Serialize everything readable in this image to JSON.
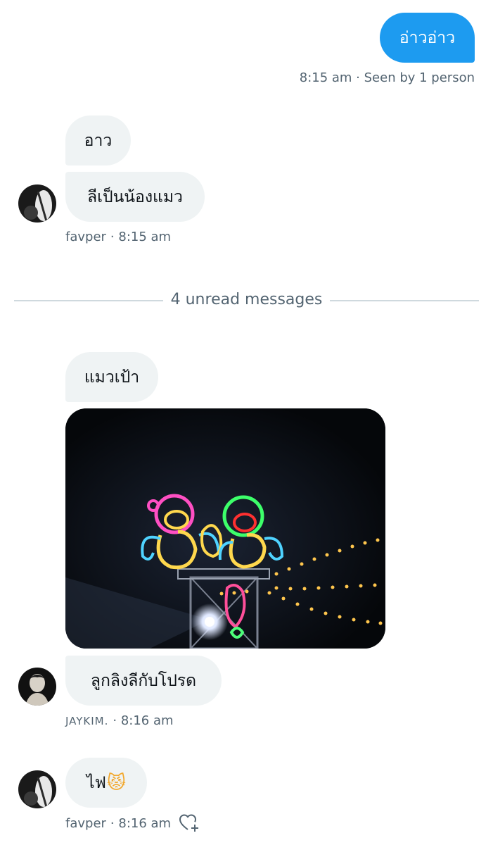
{
  "messages": {
    "sent_1": {
      "text": "อ่าวอ่าว",
      "meta": "8:15 am · Seen by 1 person"
    },
    "group_1": {
      "bubble_1": "อาว",
      "bubble_2": "ลีเป็นน้องแมว",
      "author": "favper",
      "time": "· 8:15 am"
    },
    "divider": {
      "text": "4 unread messages"
    },
    "group_2": {
      "bubble_1": "แมวเป้า",
      "bubble_2": "ลูกลิงลีกับโปรด",
      "author": "JAYKIM.",
      "time": "· 8:16 am"
    },
    "group_3": {
      "text": "ไฟ",
      "emoji": "😾",
      "author": "favper",
      "time": "· 8:16 am"
    }
  },
  "colors": {
    "sent_bubble": "#1d9bf0",
    "received_bubble": "#eff3f4",
    "meta_text": "#536471",
    "divider": "#cfd9de"
  },
  "icons": {
    "react": "heart-plus-icon"
  }
}
